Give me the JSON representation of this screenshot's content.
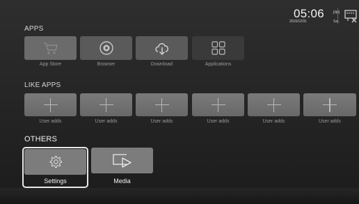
{
  "status": {
    "time": "05:06",
    "ampm": "PM",
    "date": "2016/12/31",
    "day": "Sat.",
    "network_icon": "ethernet-disconnected-icon"
  },
  "apps": {
    "title": "APPS",
    "items": [
      {
        "label": "App Store",
        "icon": "shopping-cart-icon"
      },
      {
        "label": "Browser",
        "icon": "browser-icon"
      },
      {
        "label": "Download",
        "icon": "cloud-download-icon"
      },
      {
        "label": "Applications",
        "icon": "grid-icon"
      }
    ]
  },
  "like_apps": {
    "title": "LIKE APPS",
    "items": [
      {
        "label": "User adds",
        "icon": "plus-icon"
      },
      {
        "label": "User adds",
        "icon": "plus-icon"
      },
      {
        "label": "User adds",
        "icon": "plus-icon"
      },
      {
        "label": "User adds",
        "icon": "plus-icon"
      },
      {
        "label": "User adds",
        "icon": "plus-icon"
      },
      {
        "label": "User adds",
        "icon": "plus-icon"
      }
    ]
  },
  "others": {
    "title": "OTHERS",
    "items": [
      {
        "label": "Settings",
        "icon": "gear-icon",
        "focused": true
      },
      {
        "label": "Media",
        "icon": "play-icon",
        "focused": false
      }
    ]
  },
  "colors": {
    "background": "#262626",
    "tile": "#7c7c7c",
    "focus": "#e8e8e8"
  }
}
